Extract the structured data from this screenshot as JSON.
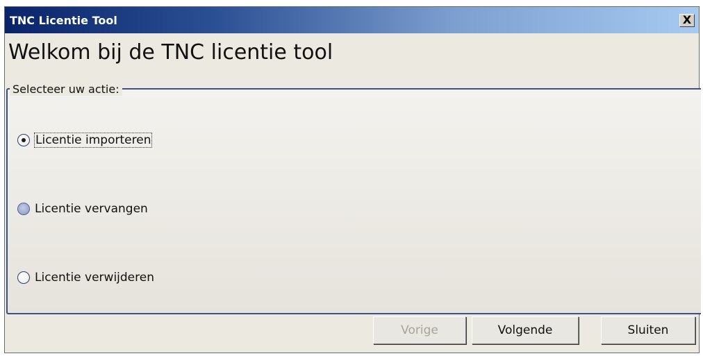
{
  "window": {
    "title": "TNC Licentie Tool",
    "close_glyph": "X"
  },
  "heading": "Welkom bij de TNC licentie tool",
  "group": {
    "legend": "Selecteer uw actie:",
    "options": [
      {
        "label": "Licentie importeren",
        "selected": true
      },
      {
        "label": "Licentie vervangen",
        "selected": false
      },
      {
        "label": "Licentie verwijderen",
        "selected": false
      }
    ]
  },
  "buttons": {
    "previous": {
      "label": "Vorige",
      "enabled": false
    },
    "next": {
      "label": "Volgende",
      "enabled": true
    },
    "close": {
      "label": "Sluiten",
      "enabled": true
    }
  }
}
